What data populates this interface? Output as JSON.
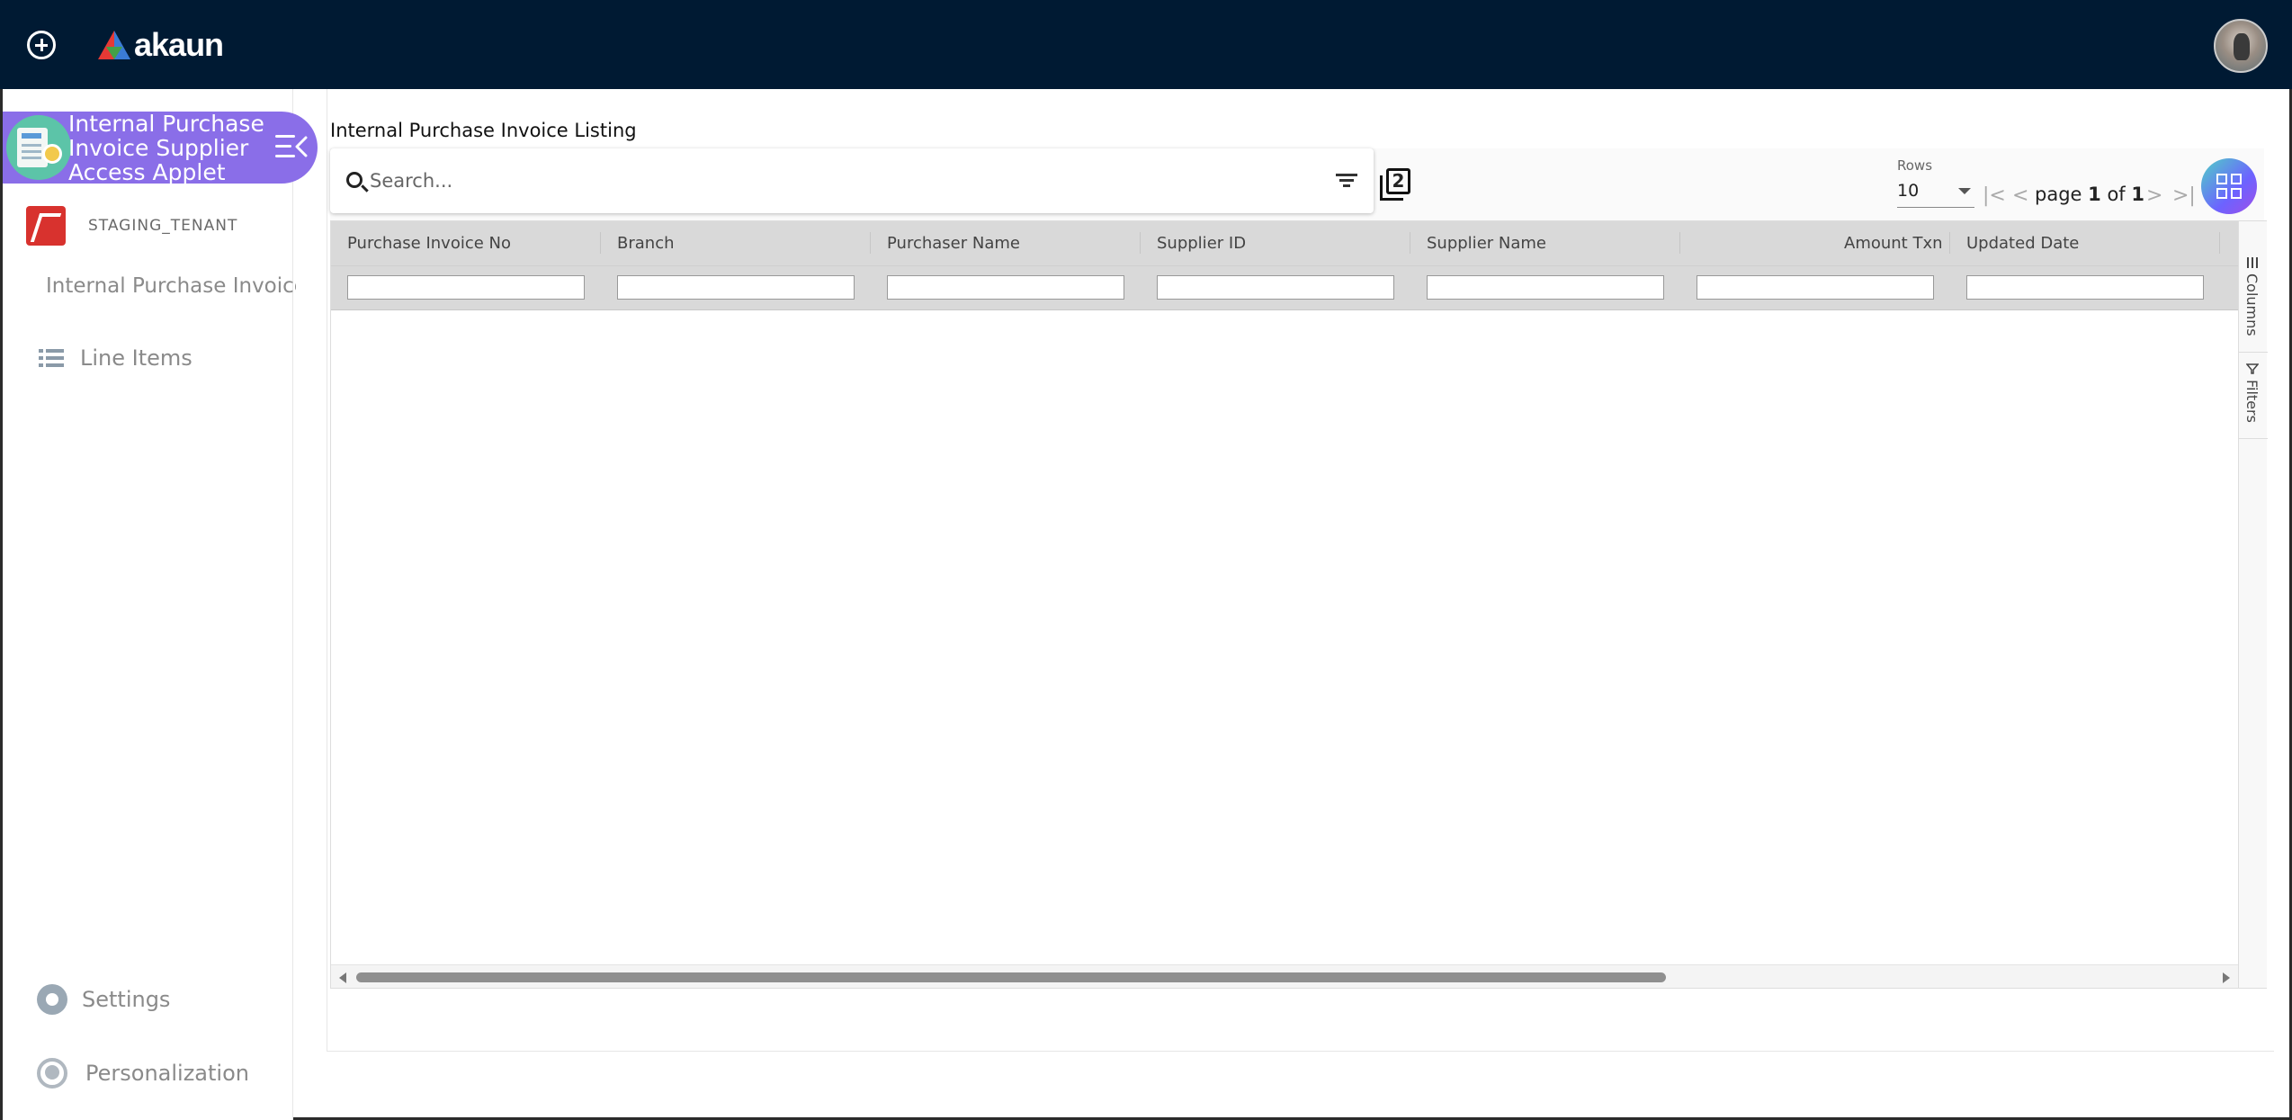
{
  "app": {
    "brand_name": "akaun"
  },
  "sidebar": {
    "applet_title": "Internal Purchase Invoice Supplier Access Applet",
    "tenant_name": "STAGING_TENANT",
    "applet_link": "Internal Purchase Invoice",
    "items": [
      {
        "label": "Line Items",
        "icon": "list-icon"
      }
    ],
    "footer": [
      {
        "label": "Settings",
        "icon": "gear-icon"
      },
      {
        "label": "Personalization",
        "icon": "person-icon"
      }
    ]
  },
  "main": {
    "title": "Internal Purchase Invoice Listing",
    "search": {
      "placeholder": "Search...",
      "value": ""
    },
    "copy_badge": "2",
    "pagination": {
      "rows_label": "Rows",
      "rows_value": "10",
      "page_word": "page",
      "page_current": "1",
      "of_word": "of",
      "page_total": "1"
    }
  },
  "grid": {
    "columns": [
      "Purchase Invoice No",
      "Branch",
      "Purchaser Name",
      "Supplier ID",
      "Supplier Name",
      "Amount Txn",
      "Updated Date"
    ],
    "rows": [],
    "side_tabs": [
      "Columns",
      "Filters"
    ]
  },
  "colors": {
    "topbar": "#001a33",
    "applet_pill": "#8a6ee8",
    "grid_header": "#d9d9d9"
  }
}
